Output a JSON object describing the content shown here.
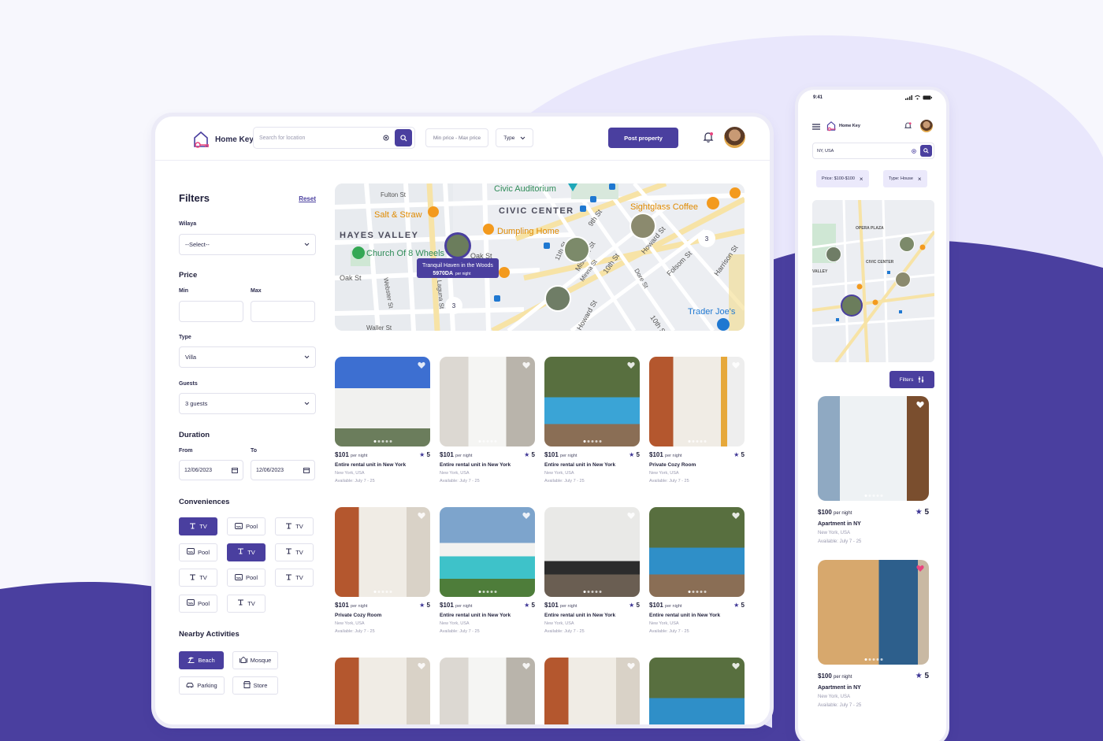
{
  "brand": {
    "name": "Home Key"
  },
  "header": {
    "search_placeholder": "Search for location",
    "price_placeholder": "Min price - Max price",
    "type_label": "Type",
    "post_label": "Post property"
  },
  "filters": {
    "title": "Filters",
    "reset": "Reset",
    "wilaya_label": "Wilaya",
    "wilaya_value": "--Select--",
    "price_title": "Price",
    "min_label": "Min",
    "max_label": "Max",
    "type_label": "Type",
    "type_value": "Villa",
    "guests_label": "Guests",
    "guests_value": "3 guests",
    "duration_title": "Duration",
    "from_label": "From",
    "to_label": "To",
    "from_value": "12/06/2023",
    "to_value": "12/06/2023",
    "conveniences_title": "Conveniences",
    "conveniences": [
      {
        "label": "TV",
        "icon": "tv-icon",
        "selected": true
      },
      {
        "label": "Pool",
        "icon": "pool-icon",
        "selected": false
      },
      {
        "label": "TV",
        "icon": "tv-icon",
        "selected": false
      },
      {
        "label": "Pool",
        "icon": "pool-icon",
        "selected": false
      },
      {
        "label": "TV",
        "icon": "tv-icon",
        "selected": true
      },
      {
        "label": "TV",
        "icon": "tv-icon",
        "selected": false
      },
      {
        "label": "TV",
        "icon": "tv-icon",
        "selected": false
      },
      {
        "label": "Pool",
        "icon": "pool-icon",
        "selected": false
      },
      {
        "label": "TV",
        "icon": "tv-icon",
        "selected": false
      },
      {
        "label": "Pool",
        "icon": "pool-icon",
        "selected": false
      },
      {
        "label": "TV",
        "icon": "tv-icon",
        "selected": false
      }
    ],
    "activities_title": "Nearby Activities",
    "activities": [
      {
        "label": "Beach",
        "icon": "beach-icon",
        "selected": true
      },
      {
        "label": "Mosque",
        "icon": "mosque-icon",
        "selected": false
      },
      {
        "label": "Parking",
        "icon": "car-icon",
        "selected": false
      },
      {
        "label": "Store",
        "icon": "store-icon",
        "selected": false
      }
    ]
  },
  "map": {
    "labels": {
      "civic_auditorium": "Civic Auditorium",
      "civic_center": "CIVIC CENTER",
      "hayes_valley": "HAYES VALLEY",
      "salt_straw": "Salt & Straw",
      "dumpling_home": "Dumpling Home",
      "sightglass": "Sightglass Coffee",
      "church": "Church Of 8 Wheels",
      "trader_joes": "Trader Joe's",
      "fulton": "Fulton St",
      "oak": "Oak St",
      "oak2": "Oak St",
      "webster": "Webster St",
      "ninth": "9th St",
      "tenth": "10th St",
      "tenth2": "10th St",
      "mission": "Mission St",
      "howard": "Howard St",
      "howard2": "Howard St",
      "folsom": "Folsom St",
      "harrison": "Harrison St",
      "minna": "Minna St",
      "dore": "Dore St",
      "eleventh": "11th St",
      "waller": "Waller St",
      "laguna": "Laguna St"
    },
    "tooltip_title": "Tranquil Haven in the Woods",
    "tooltip_price": "5970DA",
    "tooltip_unit": "per night",
    "cluster_a": "3",
    "cluster_b": "3"
  },
  "listings": [
    {
      "price": "$101",
      "unit": "per night",
      "rating": "5",
      "title": "Entire rental unit in New York",
      "location": "New York, USA",
      "available": "Available: July 7 - 25"
    },
    {
      "price": "$101",
      "unit": "per night",
      "rating": "5",
      "title": "Entire rental unit in New York",
      "location": "New York, USA",
      "available": "Available: July 7 - 25"
    },
    {
      "price": "$101",
      "unit": "per night",
      "rating": "5",
      "title": "Entire rental unit in New York",
      "location": "New York, USA",
      "available": "Available: July 7 - 25"
    },
    {
      "price": "$101",
      "unit": "per night",
      "rating": "5",
      "title": "Private Cozy Room",
      "location": "New York, USA",
      "available": "Available: July 7 - 25"
    },
    {
      "price": "$101",
      "unit": "per night",
      "rating": "5",
      "title": "Private Cozy Room",
      "location": "New York, USA",
      "available": "Available: July 7 - 25"
    },
    {
      "price": "$101",
      "unit": "per night",
      "rating": "5",
      "title": "Entire rental unit in New York",
      "location": "New York, USA",
      "available": "Available: July 7 - 25"
    },
    {
      "price": "$101",
      "unit": "per night",
      "rating": "5",
      "title": "Entire rental unit in New York",
      "location": "New York, USA",
      "available": "Available: July 7 - 25"
    },
    {
      "price": "$101",
      "unit": "per night",
      "rating": "5",
      "title": "Entire rental unit in New York",
      "location": "New York, USA",
      "available": "Available: July 7 - 25"
    }
  ],
  "mobile": {
    "time": "9:41",
    "search_value": "NY, USA",
    "tags": [
      "Price: $100-$100",
      "Type: House"
    ],
    "filters_label": "Filters",
    "map_labels": {
      "opera_plaza": "OPERA PLAZA",
      "civic_center": "CIVIC CENTER",
      "valley": "VALLEY"
    },
    "cards": [
      {
        "price": "$100",
        "unit": "per night",
        "rating": "5",
        "title": "Apartment in NY",
        "location": "New York, USA",
        "available": "Available: July 7 - 25"
      },
      {
        "price": "$100",
        "unit": "per night",
        "rating": "5",
        "title": "Apartment in NY",
        "location": "New York, USA",
        "available": "Available: July 7 - 25"
      }
    ]
  },
  "colors": {
    "primary": "#4a3f9f",
    "background_wave": "#4a3f9f",
    "light_wave": "#e8e6fb",
    "accent_pink": "#e8457f"
  }
}
